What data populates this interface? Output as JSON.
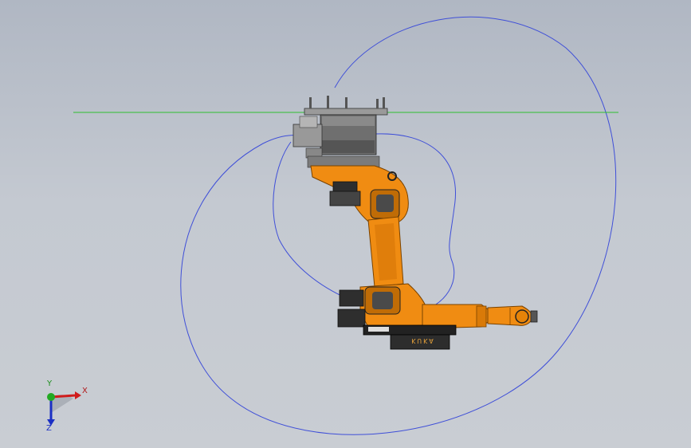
{
  "viewport": {
    "background_top": "#b0b7c3",
    "background_bottom": "#c9cdd3"
  },
  "robot": {
    "brand_text": "KUKA",
    "body_color": "#f08c12",
    "motor_color": "#3a3a3a",
    "base_color": "#8f8f8f"
  },
  "sketch": {
    "work_envelope_color": "#3f4fd8",
    "horizon_line_color": "#2fbf2f"
  },
  "triad": {
    "x_label": "X",
    "y_label": "Y",
    "z_label": "Z",
    "x_color": "#d01c1c",
    "y_color": "#22a922",
    "z_color": "#1b2fc4"
  }
}
